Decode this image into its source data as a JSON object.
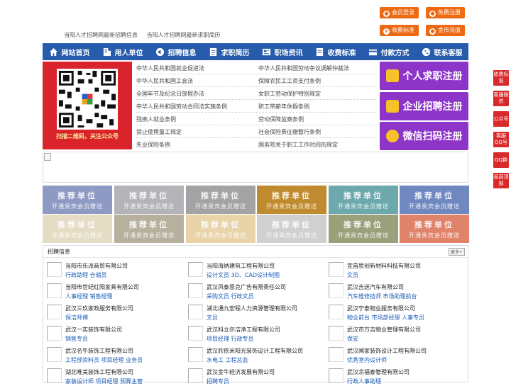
{
  "top_buttons": [
    {
      "label": "会员登录",
      "color": "#ee6a12"
    },
    {
      "label": "免费注册",
      "color": "#ee6a12"
    },
    {
      "label": "收费标准",
      "color": "#ee6a12"
    },
    {
      "label": "金币充值",
      "color": "#ee6a12"
    }
  ],
  "header_links": [
    "当阳人才招聘网最新招聘信息",
    "当阳人才招聘网最新求职简历"
  ],
  "nav": [
    {
      "label": "网站首页",
      "icon": "home-icon"
    },
    {
      "label": "用人单位",
      "icon": "building-icon"
    },
    {
      "label": "招聘信息",
      "icon": "megaphone-icon"
    },
    {
      "label": "求职简历",
      "icon": "resume-icon"
    },
    {
      "label": "职场资讯",
      "icon": "news-icon"
    },
    {
      "label": "收费标准",
      "icon": "document-icon"
    },
    {
      "label": "付款方式",
      "icon": "payment-icon"
    },
    {
      "label": "联系客服",
      "icon": "phone-icon"
    }
  ],
  "qr_caption": "扫描二维码，关注公众号",
  "laws_left": [
    "中华人民共和国就业促进法",
    "中华人民共和国工会法",
    "全国年节及纪念日放假办法",
    "中华人民共和国劳动合同法实施条例",
    "残疾人就业条例",
    "禁止使用童工规定",
    "失业保险条例"
  ],
  "laws_right": [
    "中华人民共和国劳动争议调解仲裁法",
    "保障农民工工资支付条例",
    "女职工劳动保护特别规定",
    "职工带薪年休假条例",
    "劳动保障监察条例",
    "社会保险费征缴暂行条例",
    "国务院关于职工工作时间的规定"
  ],
  "register": [
    {
      "label": "个人求职注册"
    },
    {
      "label": "企业招聘注册"
    },
    {
      "label": "微信扫码注册"
    }
  ],
  "recommend": {
    "title": "推荐单位",
    "sub": "开通贵宾会员赠送",
    "colors": [
      "#8f9ac4",
      "#b4b4b8",
      "#a3a3a3",
      "#c08b2e",
      "#6da8ac",
      "#6f88c0",
      "#e4dcc4",
      "#b7b09d",
      "#e9d4a9",
      "#d0d0d0",
      "#9aa07a",
      "#e0836a",
      "#8ab1b6",
      "#e2dcc9"
    ]
  },
  "jobs_section": {
    "title": "招聘信息",
    "more": "更多+"
  },
  "jobs": [
    {
      "company": "当阳市乐派商贸有限公司",
      "positions": "行政助理 仓储员"
    },
    {
      "company": "当阳海纳建筑工程有限公司",
      "positions": "设计文员 3D、CAD设计制图"
    },
    {
      "company": "宜昌思创新材料科技有限公司",
      "positions": "文员"
    },
    {
      "company": "当阳市世纪红阳家具有限公司",
      "positions": "人事经理 销售经理"
    },
    {
      "company": "武汉风泰恩克广告有限责任公司",
      "positions": "采购文员 行政文员"
    },
    {
      "company": "武汉吉送汽车有限公司",
      "positions": "汽车维修技师 市场助理前台"
    },
    {
      "company": "武汉三玖家政服务有限公司",
      "positions": "保洁师傅"
    },
    {
      "company": "湖北通九宏程人力资源管理有限公司",
      "positions": "文员"
    },
    {
      "company": "武汉宁泰物业服务有限公司",
      "positions": "物业前台 市场部经理 人事专员"
    },
    {
      "company": "武汉一实装饰有限公司",
      "positions": "销售专员"
    },
    {
      "company": "武汉科立尔洁净工程有限公司",
      "positions": "项目经理 行政专员"
    },
    {
      "company": "武汉市万吉物业管理有限公司",
      "positions": "保安"
    },
    {
      "company": "武汉名牛装饰工程有限公司",
      "positions": "工程部资料员 项目经理 业务员"
    },
    {
      "company": "武汉欣依米阳光装饰设计工程有限公司",
      "positions": "水电工 工程总监"
    },
    {
      "company": "武汉闻家装饰设计工程有限公司",
      "positions": "优秀室内设计师"
    },
    {
      "company": "湖北唯美装饰工程有限公司",
      "positions": "家装设计师 项目经理 预算主管"
    },
    {
      "company": "武汉金牛经济发展有限公司",
      "positions": "招聘专员"
    },
    {
      "company": "武汉余福泰管理有限公司",
      "positions": "行政人事助理"
    }
  ],
  "side": [
    "收费标准",
    "客服微信",
    "公众号",
    "客服QQ号",
    "QQ群",
    "返回顶部"
  ]
}
